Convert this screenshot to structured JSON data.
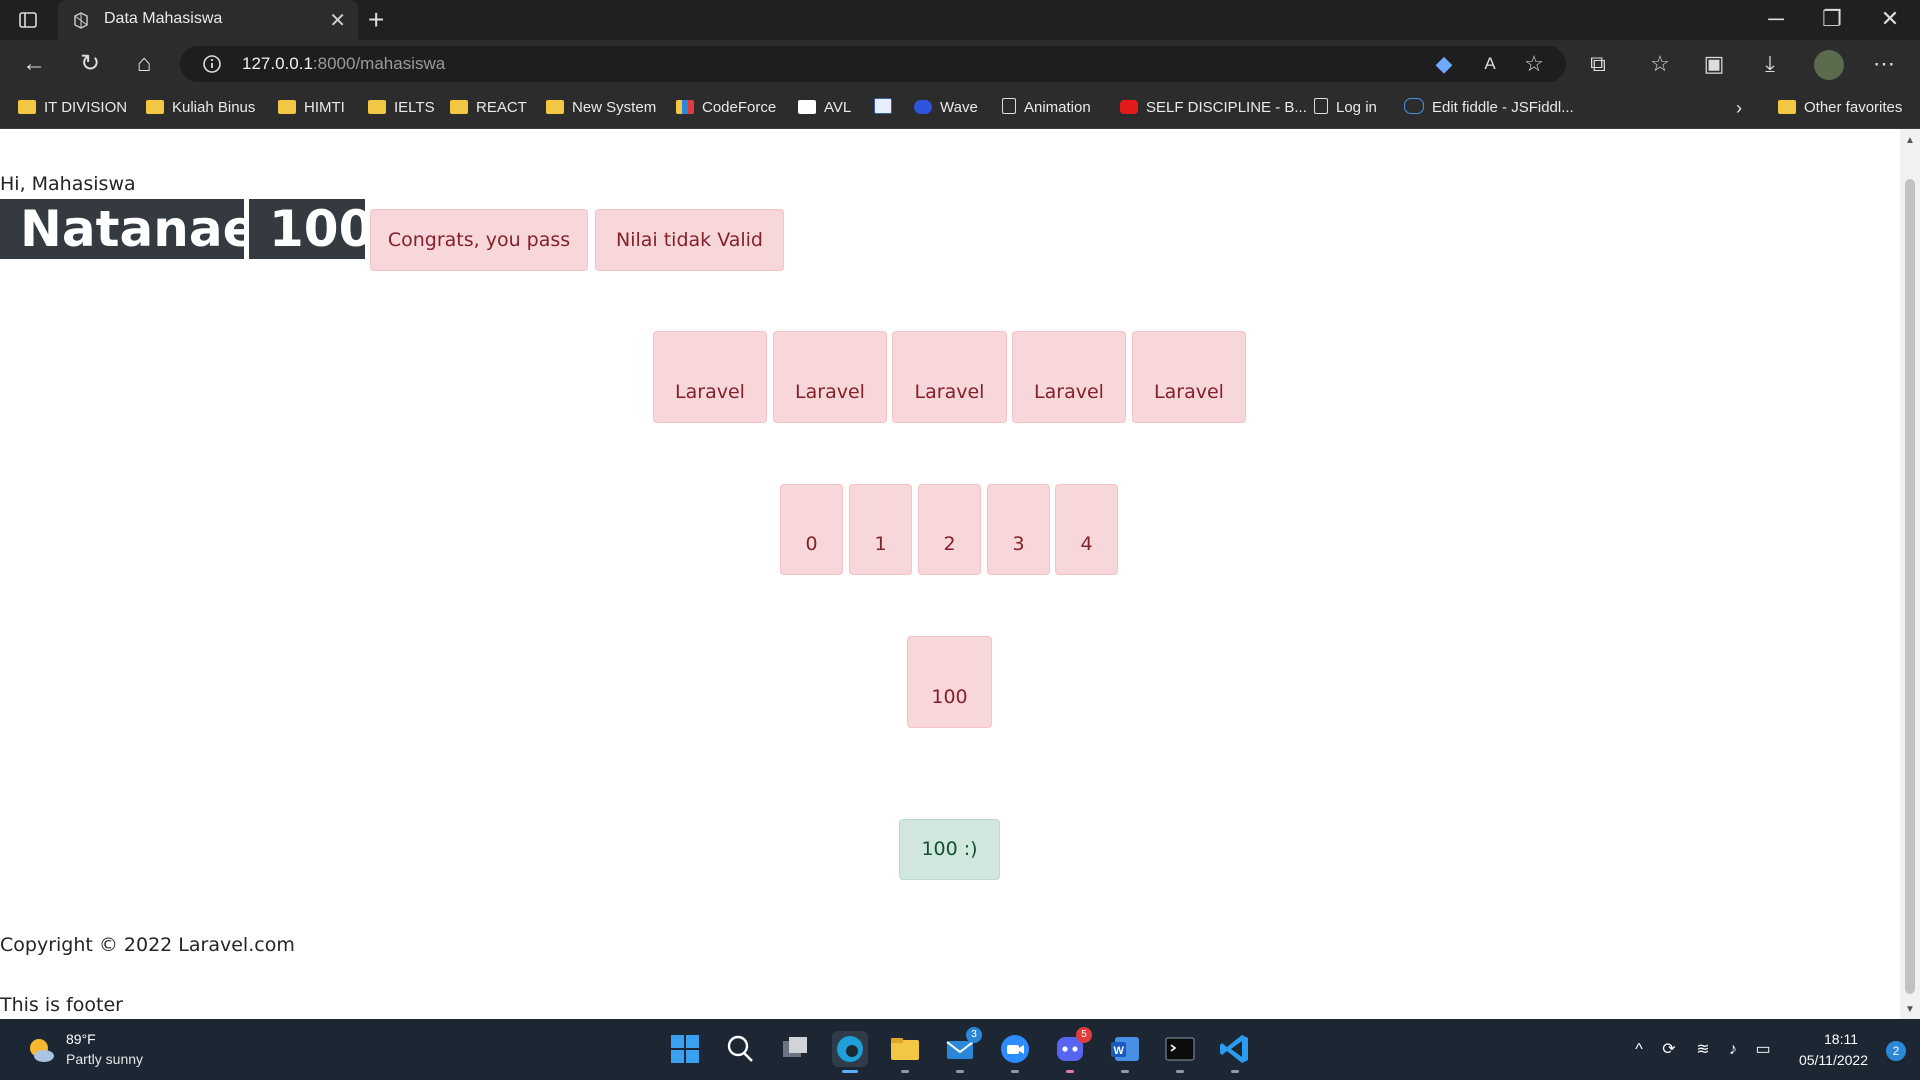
{
  "browser": {
    "tab_title": "Data Mahasiswa",
    "url_host": "127.0.0.1",
    "url_rest": ":8000/mahasiswa",
    "bookmarks": [
      {
        "label": "IT DIVISION",
        "icon": "folder-icon"
      },
      {
        "label": "Kuliah Binus",
        "icon": "folder-icon"
      },
      {
        "label": "HIMTI",
        "icon": "folder-icon"
      },
      {
        "label": "IELTS",
        "icon": "folder-icon"
      },
      {
        "label": "REACT",
        "icon": "folder-icon"
      },
      {
        "label": "New System",
        "icon": "folder-icon"
      },
      {
        "label": "CodeForce",
        "icon": "bar-chart-icon"
      },
      {
        "label": "AVL",
        "icon": "avl-icon"
      },
      {
        "label": "",
        "icon": "document-blue-icon"
      },
      {
        "label": "Wave",
        "icon": "wave-icon"
      },
      {
        "label": "Animation",
        "icon": "page-icon"
      },
      {
        "label": "SELF DISCIPLINE - B...",
        "icon": "youtube-icon"
      },
      {
        "label": "Log in",
        "icon": "page-icon"
      },
      {
        "label": "Edit fiddle - JSFiddl...",
        "icon": "cloud-icon"
      }
    ],
    "other_favorites": "Other favorites"
  },
  "page": {
    "greeting": "Hi, Mahasiswa",
    "name_badge": "Natanael",
    "score_badge": "100",
    "pass_alert": "Congrats, you pass",
    "invalid_alert": "Nilai tidak Valid",
    "laravel_boxes": [
      "Laravel",
      "Laravel",
      "Laravel",
      "Laravel",
      "Laravel"
    ],
    "index_boxes": [
      "0",
      "1",
      "2",
      "3",
      "4"
    ],
    "score_box": "100",
    "success_box": "100 :)",
    "copyright": "Copyright © 2022 Laravel.com",
    "footer": "This is footer"
  },
  "taskbar": {
    "weather_temp": "89°F",
    "weather_desc": "Partly sunny",
    "mail_badge": "3",
    "discord_badge": "5",
    "time": "18:11",
    "date": "05/11/2022",
    "notifications": "2"
  },
  "colors": {
    "alert_pink_bg": "#f8d7da",
    "alert_green_bg": "#d1e7dd",
    "badge_dark": "#343a40"
  }
}
